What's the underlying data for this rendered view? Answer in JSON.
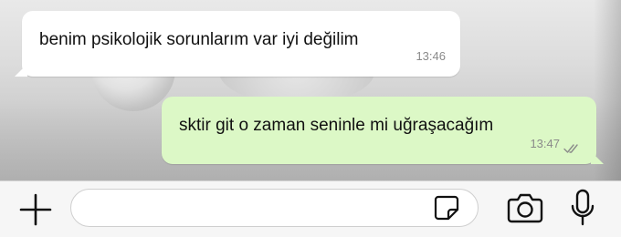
{
  "messages": [
    {
      "direction": "incoming",
      "text": "benim psikolojik sorunlarım var iyi değilim",
      "time": "13:46"
    },
    {
      "direction": "outgoing",
      "text": "sktir git o zaman seninle mi uğraşacağım",
      "time": "13:47",
      "status": "read"
    }
  ],
  "composer": {
    "value": "",
    "icons": {
      "attach": "plus-icon",
      "sticker": "sticker-icon",
      "camera": "camera-icon",
      "mic": "microphone-icon"
    }
  },
  "colors": {
    "incoming_bubble": "#ffffff",
    "outgoing_bubble": "#dcf8c6",
    "timestamp": "#8a8a8a",
    "icon": "#111111"
  }
}
